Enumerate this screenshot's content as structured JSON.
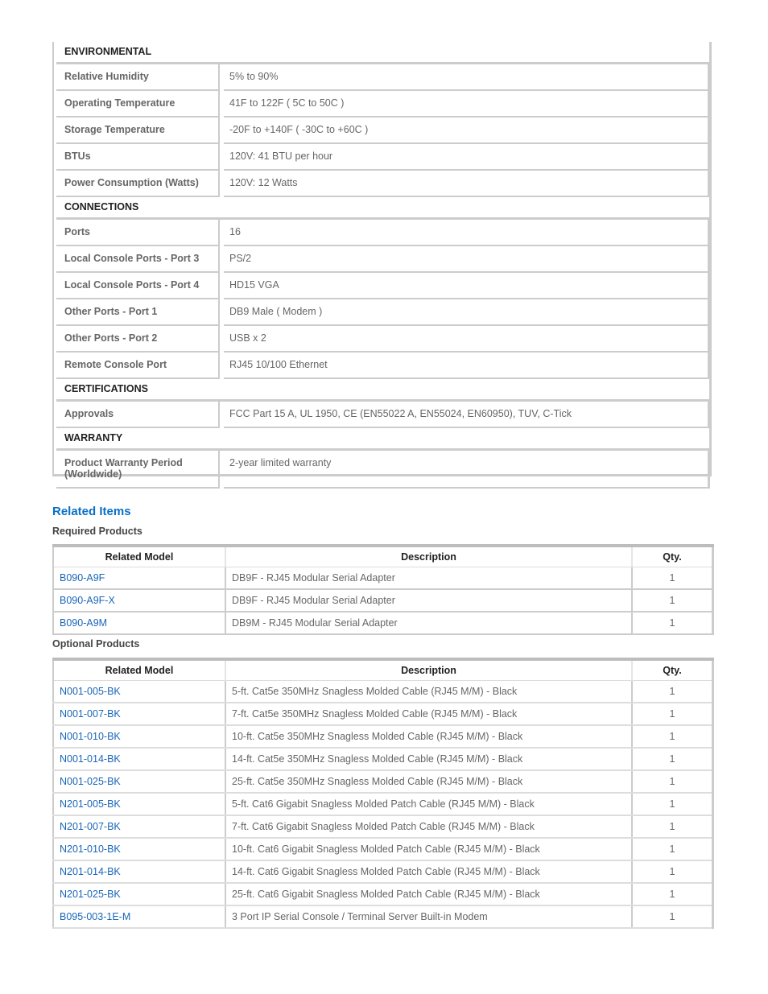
{
  "specs": {
    "sections": [
      {
        "title": "ENVIRONMENTAL",
        "rows": [
          {
            "label": "Relative Humidity",
            "value": "5% to 90%"
          },
          {
            "label": "Operating Temperature",
            "value": "41F to 122F ( 5C to 50C )"
          },
          {
            "label": "Storage Temperature",
            "value": "-20F to +140F ( -30C to +60C )"
          },
          {
            "label": "BTUs",
            "value": "120V: 41 BTU per hour"
          },
          {
            "label": "Power Consumption (Watts)",
            "value": "120V: 12 Watts"
          }
        ]
      },
      {
        "title": "CONNECTIONS",
        "rows": [
          {
            "label": "Ports",
            "value": "16"
          },
          {
            "label": "Local Console Ports - Port 3",
            "value": "PS/2"
          },
          {
            "label": "Local Console Ports - Port 4",
            "value": "HD15 VGA"
          },
          {
            "label": "Other Ports - Port 1",
            "value": "DB9 Male ( Modem )"
          },
          {
            "label": "Other Ports - Port 2",
            "value": "USB x 2"
          },
          {
            "label": "Remote Console Port",
            "value": "RJ45 10/100 Ethernet"
          }
        ]
      },
      {
        "title": "CERTIFICATIONS",
        "rows": [
          {
            "label": "Approvals",
            "value": "FCC Part 15 A, UL 1950, CE (EN55022 A, EN55024, EN60950), TUV, C-Tick"
          }
        ]
      },
      {
        "title": "WARRANTY",
        "rows": [
          {
            "label": "Product Warranty Period (Worldwide)",
            "value": "2-year limited warranty"
          }
        ]
      }
    ]
  },
  "related": {
    "title": "Related Items",
    "columns": [
      "Related Model",
      "Description",
      "Qty."
    ],
    "required": {
      "title": "Required Products",
      "rows": [
        {
          "model": "B090-A9F",
          "description": "DB9F - RJ45 Modular Serial Adapter",
          "qty": "1"
        },
        {
          "model": "B090-A9F-X",
          "description": "DB9F - RJ45 Modular Serial Adapter",
          "qty": "1"
        },
        {
          "model": "B090-A9M",
          "description": "DB9M - RJ45 Modular Serial Adapter",
          "qty": "1"
        }
      ]
    },
    "optional": {
      "title": "Optional Products",
      "rows": [
        {
          "model": "N001-005-BK",
          "description": "5-ft. Cat5e 350MHz Snagless Molded Cable (RJ45 M/M) - Black",
          "qty": "1"
        },
        {
          "model": "N001-007-BK",
          "description": "7-ft. Cat5e 350MHz Snagless Molded Cable (RJ45 M/M) - Black",
          "qty": "1"
        },
        {
          "model": "N001-010-BK",
          "description": "10-ft. Cat5e 350MHz Snagless Molded Cable (RJ45 M/M) - Black",
          "qty": "1"
        },
        {
          "model": "N001-014-BK",
          "description": "14-ft. Cat5e 350MHz Snagless Molded Cable (RJ45 M/M) - Black",
          "qty": "1"
        },
        {
          "model": "N001-025-BK",
          "description": "25-ft. Cat5e 350MHz Snagless Molded Cable (RJ45 M/M) - Black",
          "qty": "1"
        },
        {
          "model": "N201-005-BK",
          "description": "5-ft. Cat6 Gigabit Snagless Molded Patch Cable (RJ45 M/M) - Black",
          "qty": "1"
        },
        {
          "model": "N201-007-BK",
          "description": "7-ft. Cat6 Gigabit Snagless Molded Patch Cable (RJ45 M/M) - Black",
          "qty": "1"
        },
        {
          "model": "N201-010-BK",
          "description": "10-ft. Cat6 Gigabit Snagless Molded Patch Cable (RJ45 M/M) - Black",
          "qty": "1"
        },
        {
          "model": "N201-014-BK",
          "description": "14-ft. Cat6 Gigabit Snagless Molded Patch Cable (RJ45 M/M) - Black",
          "qty": "1"
        },
        {
          "model": "N201-025-BK",
          "description": "25-ft. Cat6 Gigabit Snagless Molded Patch Cable (RJ45 M/M) - Black",
          "qty": "1"
        },
        {
          "model": "B095-003-1E-M",
          "description": "3 Port IP Serial Console / Terminal Server Built-in Modem",
          "qty": "1"
        }
      ]
    }
  },
  "colors": {
    "heading_blue": "#0a6fc7",
    "link_blue": "#1a66b8",
    "border_gray": "#cccccc",
    "text_gray": "#666666"
  }
}
